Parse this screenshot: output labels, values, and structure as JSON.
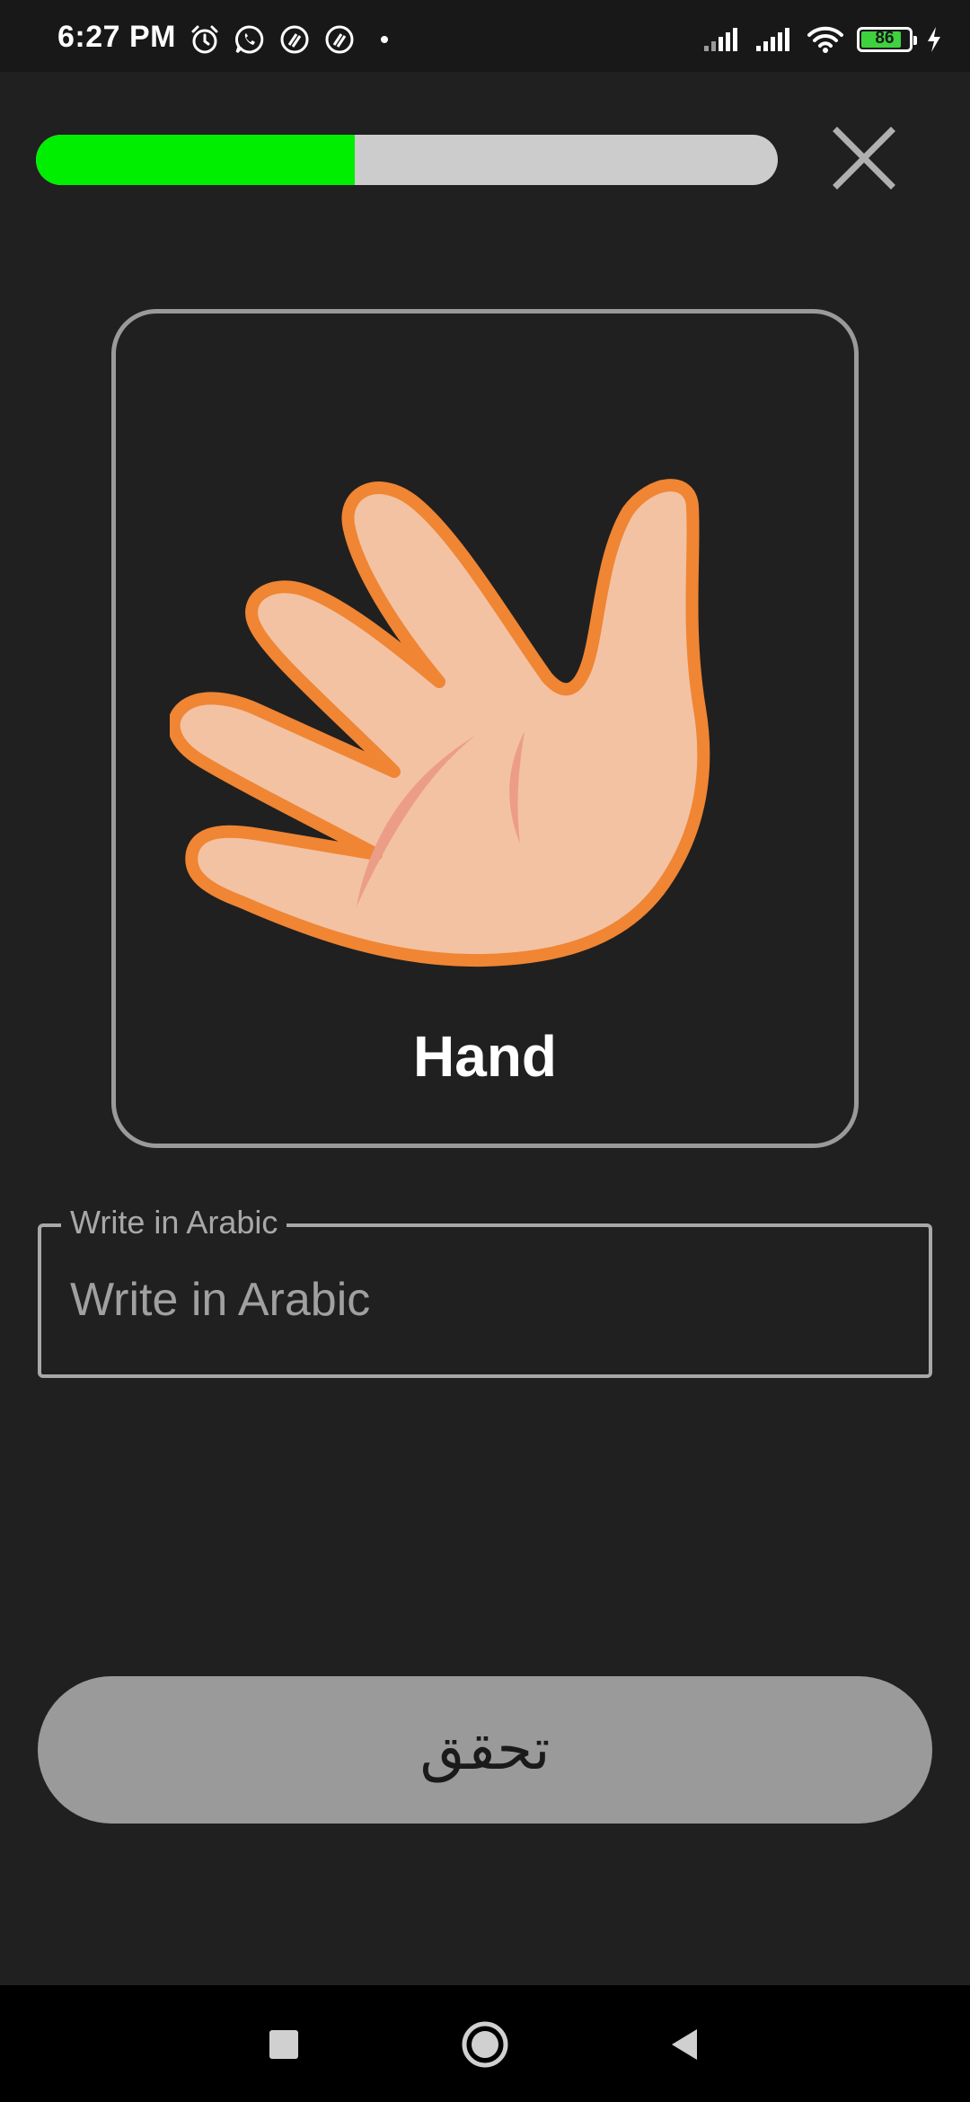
{
  "status_bar": {
    "time": "6:27 PM",
    "battery_level": "86",
    "battery_fraction": 0.86,
    "notification_icons": [
      "alarm-icon",
      "whatsapp-icon",
      "app-notification-icon",
      "app-notification-icon"
    ],
    "system_icons": [
      "signal-icon",
      "signal-icon",
      "wifi-icon",
      "battery-icon",
      "charging-icon"
    ]
  },
  "progress": {
    "fraction": 0.43,
    "fill_color": "#00ee00",
    "track_color": "#cccccc"
  },
  "card": {
    "image_icon": "hand-icon",
    "word": "Hand"
  },
  "answer_input": {
    "label": "Write in Arabic",
    "placeholder": "Write in Arabic",
    "value": ""
  },
  "check_button": {
    "label": "تحقق"
  },
  "nav_bar": {
    "buttons": [
      "recents-icon",
      "home-icon",
      "back-icon"
    ]
  },
  "colors": {
    "background": "#202020",
    "card_border": "#9a9a9a",
    "button_bg": "#9a9a9a",
    "hand_fill": "#f2c2a3",
    "hand_outline": "#f08533"
  }
}
